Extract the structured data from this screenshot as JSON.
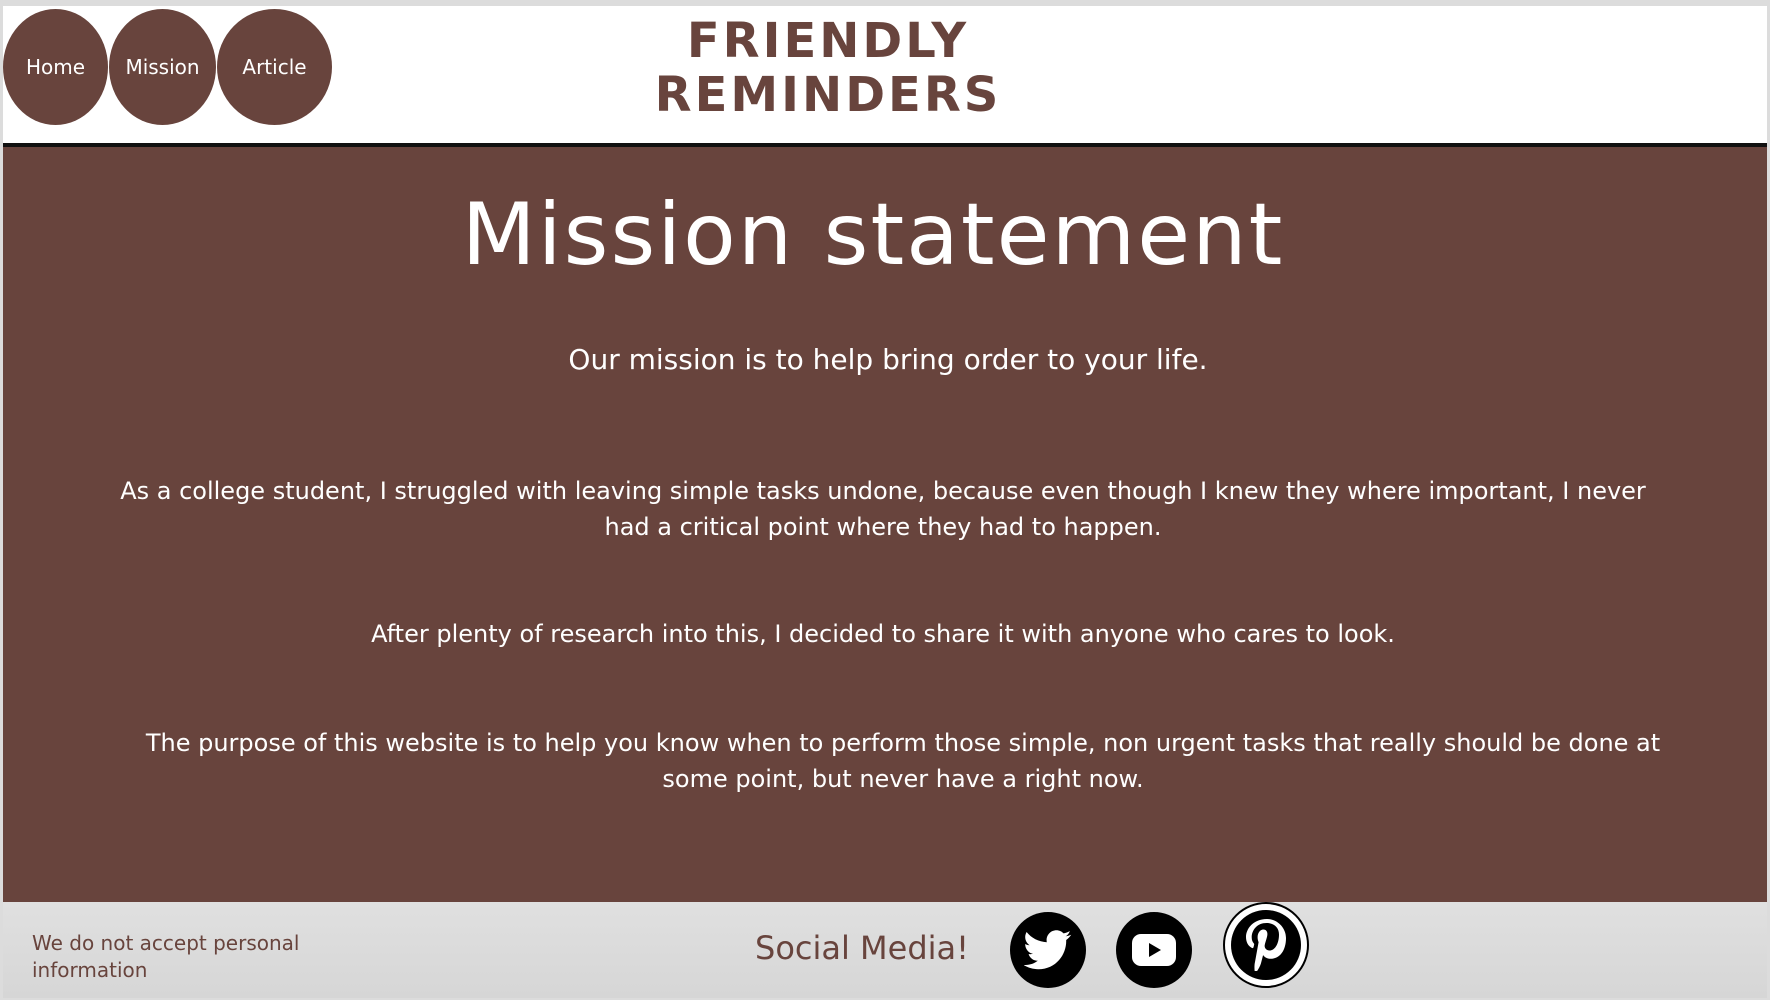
{
  "nav": {
    "items": [
      {
        "label": "Home"
      },
      {
        "label": "Mission"
      },
      {
        "label": "Article"
      }
    ]
  },
  "header": {
    "title_line1": "FRIENDLY",
    "title_line2": "REMINDERS"
  },
  "main": {
    "heading": "Mission statement",
    "intro": "Our mission is to help bring order to your life.",
    "paragraphs": [
      "As a college student, I struggled with leaving simple tasks undone, because even though I knew they where important, I never had a critical point where they had to happen.",
      "After plenty of research into this, I decided to share it with anyone who cares to look.",
      "The purpose of this website is to help you know when to perform those simple, non urgent tasks that really should be done at some point, but never have a right now."
    ]
  },
  "footer": {
    "privacy": "We do not accept personal information",
    "social_label": "Social Media!",
    "social_icons": [
      "twitter-icon",
      "youtube-icon",
      "pinterest-icon"
    ]
  },
  "colors": {
    "brand_brown": "#68443d",
    "footer_gray": "#dcdcdc"
  }
}
